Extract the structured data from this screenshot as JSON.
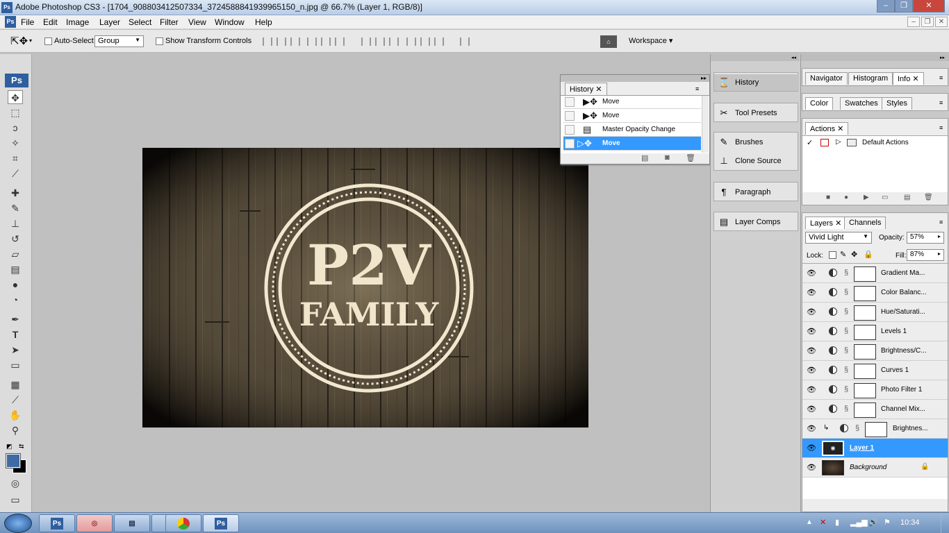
{
  "window": {
    "title": "Adobe Photoshop CS3 - [1704_908803412507334_3724588841939965150_n.jpg @ 66.7% (Layer 1, RGB/8)]"
  },
  "menu": [
    "File",
    "Edit",
    "Image",
    "Layer",
    "Select",
    "Filter",
    "View",
    "Window",
    "Help"
  ],
  "options": {
    "auto_select": "Auto-Select:",
    "auto_select_value": "Group",
    "show_transform": "Show Transform Controls",
    "workspace": "Workspace ▾"
  },
  "history": {
    "tab": "History",
    "items": [
      {
        "label": "Move",
        "icon": "move-icon",
        "selected": false
      },
      {
        "label": "Move",
        "icon": "move-icon",
        "selected": false
      },
      {
        "label": "Master Opacity Change",
        "icon": "layer-icon",
        "selected": false
      },
      {
        "label": "Move",
        "icon": "move-icon",
        "selected": true
      }
    ]
  },
  "dock": {
    "items": [
      "History",
      "Tool Presets",
      "Brushes",
      "Clone Source",
      "Paragraph",
      "Layer Comps"
    ]
  },
  "nav_tabs": [
    "Navigator",
    "Histogram",
    "Info"
  ],
  "color_tabs": [
    "Color",
    "Swatches",
    "Styles"
  ],
  "actions": {
    "tab": "Actions",
    "default_set": "Default Actions"
  },
  "layers": {
    "tabs": [
      "Layers",
      "Channels"
    ],
    "blend_mode": "Vivid Light",
    "opacity_label": "Opacity:",
    "opacity": "57%",
    "lock_label": "Lock:",
    "fill_label": "Fill:",
    "fill": "87%",
    "items": [
      {
        "name": "Gradient Ma...",
        "type": "adjustment"
      },
      {
        "name": "Color Balanc...",
        "type": "adjustment"
      },
      {
        "name": "Hue/Saturati...",
        "type": "adjustment"
      },
      {
        "name": "Levels 1",
        "type": "adjustment"
      },
      {
        "name": "Brightness/C...",
        "type": "adjustment"
      },
      {
        "name": "Curves 1",
        "type": "adjustment"
      },
      {
        "name": "Photo Filter 1",
        "type": "adjustment"
      },
      {
        "name": "Channel Mix...",
        "type": "adjustment"
      },
      {
        "name": "Brightnes...",
        "type": "clipped"
      },
      {
        "name": "Layer 1",
        "type": "pixel",
        "selected": true
      },
      {
        "name": "Background",
        "type": "background"
      }
    ]
  },
  "artwork": {
    "line1": "P2V",
    "line2": "FAMILY"
  },
  "taskbar": {
    "time": "10:34"
  },
  "colors": {
    "accent": "#3399ff",
    "fg_swatch": "#3f6aa3"
  }
}
